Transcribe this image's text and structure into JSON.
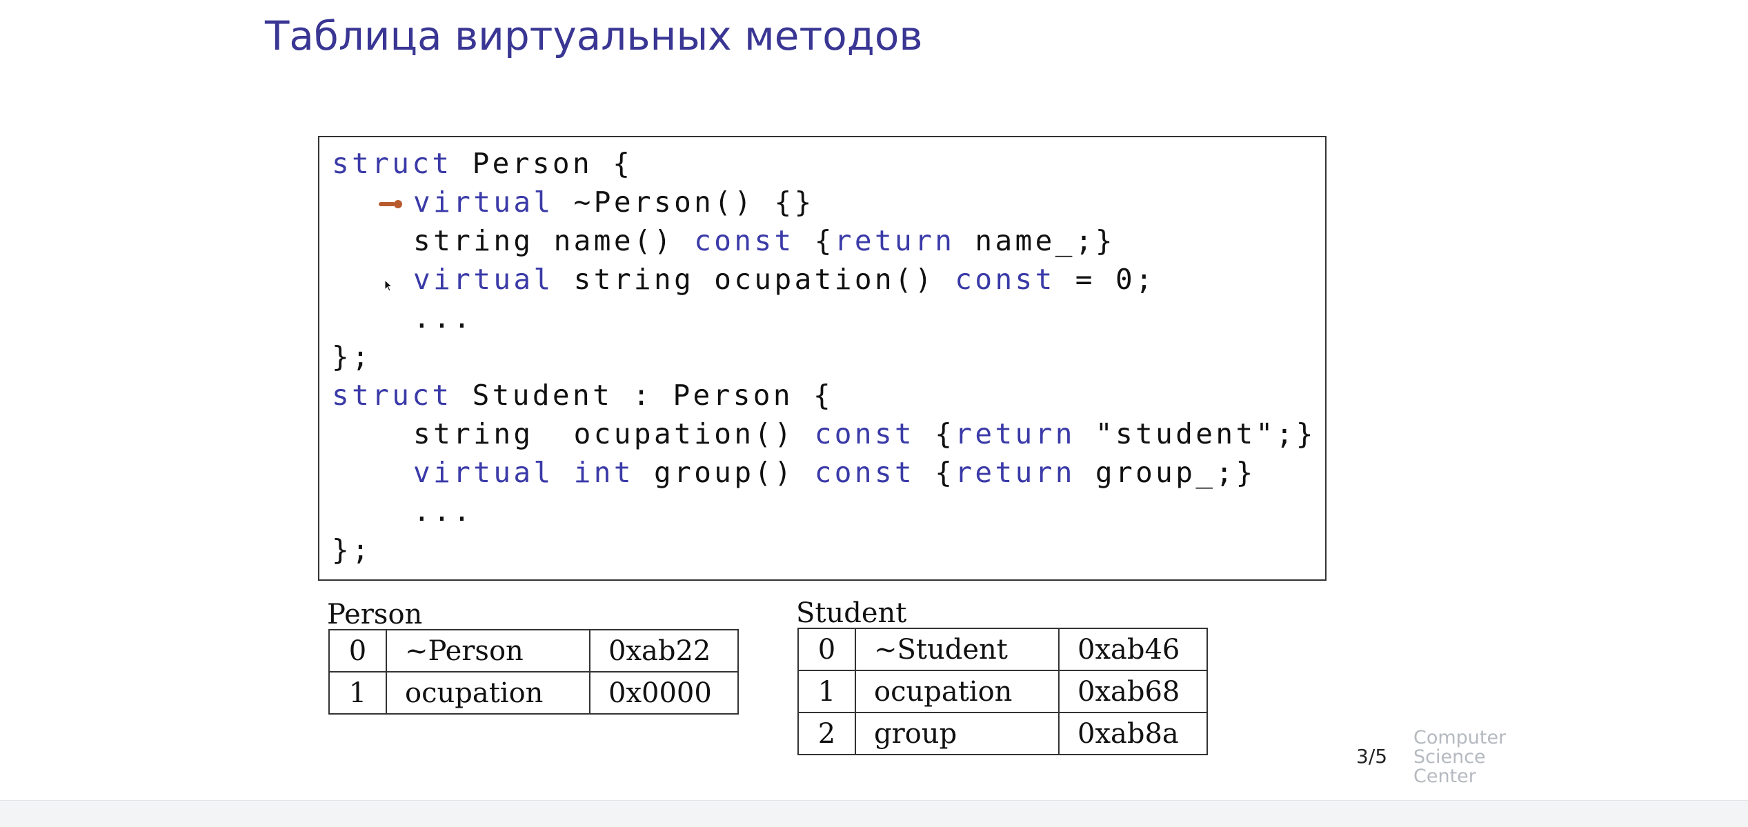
{
  "slide": {
    "title": "Таблица виртуальных методов",
    "page_number": "3/5"
  },
  "code": {
    "lines": [
      {
        "kw1": "struct",
        "rest": " Person {"
      },
      {
        "kw1": "virtual",
        "rest": " ~Person() {}"
      },
      {
        "p1": "string name() ",
        "kw1": "const",
        "p2": " {",
        "kw2": "return",
        "p3": " name_;}"
      },
      {
        "kw1": "virtual",
        "p1": " string ocupation() ",
        "kw2": "const",
        "p2": " = 0;"
      },
      {
        "text": "..."
      },
      {
        "text": "};"
      },
      {
        "kw1": "struct",
        "rest": " Student : Person {"
      },
      {
        "p1": "string  ocupation() ",
        "kw1": "const",
        "p2": " {",
        "kw2": "return",
        "p3": " \"student\";}"
      },
      {
        "kw1": "virtual",
        "p1": " ",
        "kw2": "int",
        "p2": " group() ",
        "kw3": "const",
        "p3": " {",
        "kw4": "return",
        "p4": " group_;}"
      },
      {
        "text": "..."
      },
      {
        "text": "};"
      }
    ]
  },
  "vtables": {
    "person": {
      "caption": "Person",
      "rows": [
        {
          "idx": "0",
          "name": "~Person",
          "addr": "0xab22"
        },
        {
          "idx": "1",
          "name": "ocupation",
          "addr": "0x0000"
        }
      ]
    },
    "student": {
      "caption": "Student",
      "rows": [
        {
          "idx": "0",
          "name": "~Student",
          "addr": "0xab46"
        },
        {
          "idx": "1",
          "name": "ocupation",
          "addr": "0xab68"
        },
        {
          "idx": "2",
          "name": "group",
          "addr": "0xab8a"
        }
      ]
    }
  },
  "logo": {
    "line1": "Computer",
    "line2": "Science",
    "line3": "Center"
  },
  "colors": {
    "title": "#3a3694",
    "keyword": "#3a3aa8",
    "pointer_arrow": "#b85a2e"
  },
  "icons": {
    "pointer": "laser-pointer-arrow-icon",
    "cursor": "mouse-cursor-icon"
  }
}
